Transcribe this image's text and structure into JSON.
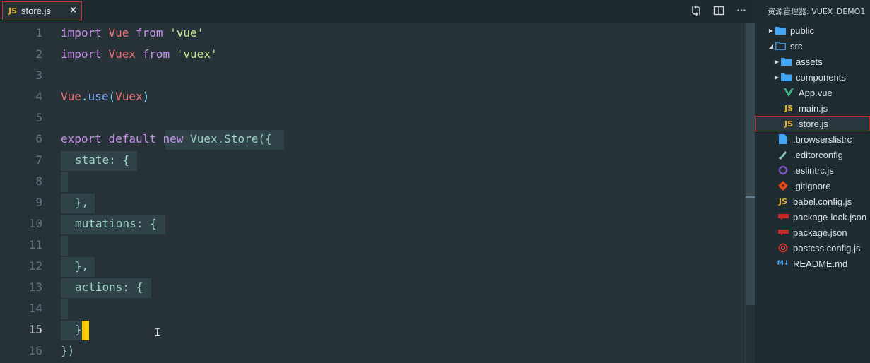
{
  "tab": {
    "label": "store.js",
    "badge": "JS",
    "close": "×"
  },
  "toolbar": {
    "more": "···"
  },
  "editor": {
    "active_line": 15,
    "lines": [
      {
        "n": "1"
      },
      {
        "n": "2"
      },
      {
        "n": "3"
      },
      {
        "n": "4"
      },
      {
        "n": "5"
      },
      {
        "n": "6"
      },
      {
        "n": "7"
      },
      {
        "n": "8"
      },
      {
        "n": "9"
      },
      {
        "n": "10"
      },
      {
        "n": "11"
      },
      {
        "n": "12"
      },
      {
        "n": "13"
      },
      {
        "n": "14"
      },
      {
        "n": "15"
      },
      {
        "n": "16"
      }
    ],
    "tokens": {
      "l1": [
        "import",
        "Vue",
        "from",
        "'vue'"
      ],
      "l2": [
        "import",
        "Vuex",
        "from",
        "'vuex'"
      ],
      "l4": [
        "Vue",
        ".",
        "use",
        "(",
        "Vuex",
        ")"
      ],
      "l6": [
        "export",
        "default",
        "new",
        "Vuex",
        ".",
        "Store",
        "({"
      ],
      "l7": "state: {",
      "l9": "},",
      "l10": "mutations: {",
      "l12": "},",
      "l13": "actions: {",
      "l15": "}",
      "l16": "})"
    }
  },
  "explorer": {
    "title": "资源管理器: VUEX_DEMO1",
    "items": [
      {
        "label": "public"
      },
      {
        "label": "src"
      },
      {
        "label": "assets"
      },
      {
        "label": "components"
      },
      {
        "label": "App.vue"
      },
      {
        "label": "main.js",
        "badge": "JS"
      },
      {
        "label": "store.js",
        "badge": "JS"
      },
      {
        "label": ".browserslistrc"
      },
      {
        "label": ".editorconfig"
      },
      {
        "label": ".eslintrc.js"
      },
      {
        "label": ".gitignore"
      },
      {
        "label": "babel.config.js",
        "badge": "JS"
      },
      {
        "label": "package-lock.json"
      },
      {
        "label": "package.json"
      },
      {
        "label": "postcss.config.js"
      },
      {
        "label": "README.md",
        "badge": "M↓"
      }
    ]
  },
  "colors": {
    "keyword": "#c792ea",
    "class": "#f07178",
    "string": "#c3e88d",
    "function": "#82aaff",
    "cursor": "#ffcc00",
    "folder": "#42a5f5",
    "js_badge": "#e6b422",
    "selection_border": "#c62828"
  }
}
